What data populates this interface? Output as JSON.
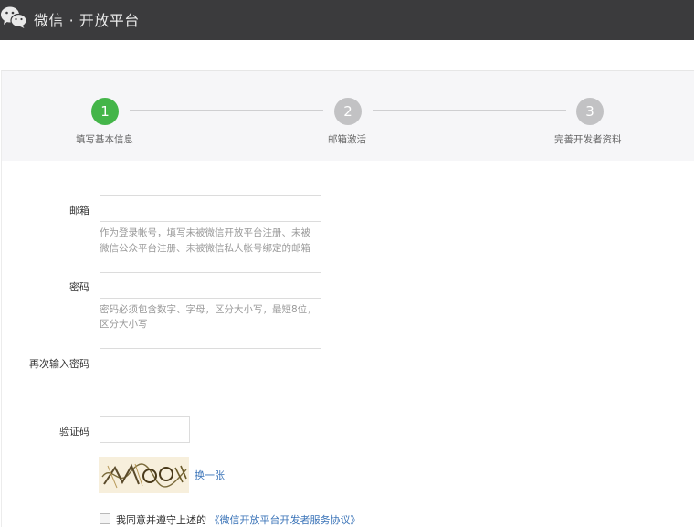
{
  "header": {
    "brand": "微信 · 开放平台",
    "bg_color": "#3b3b3d"
  },
  "steps": [
    {
      "number": "1",
      "label": "填写基本信息",
      "state": "active"
    },
    {
      "number": "2",
      "label": "邮箱激活",
      "state": "pending"
    },
    {
      "number": "3",
      "label": "完善开发者资料",
      "state": "pending"
    }
  ],
  "colors": {
    "active_step": "#44b549",
    "pending_step": "#c2c2c4",
    "link": "#3b74b8"
  },
  "form": {
    "email": {
      "label": "邮箱",
      "value": "",
      "hint_line1": "作为登录帐号，填写未被微信开放平台注册、未被",
      "hint_line2": "微信公众平台注册、未被微信私人帐号绑定的邮箱"
    },
    "password": {
      "label": "密码",
      "value": "",
      "hint_line1": "密码必须包含数字、字母，区分大小写，最短8位，",
      "hint_line2": "区分大小写"
    },
    "confirm_password": {
      "label": "再次输入密码",
      "value": ""
    },
    "captcha": {
      "label": "验证码",
      "value": "",
      "refresh_label": "换一张"
    }
  },
  "agreement": {
    "prefix": "我同意并遵守上述的",
    "link": "《微信开放平台开发者服务协议》",
    "checked": false
  }
}
